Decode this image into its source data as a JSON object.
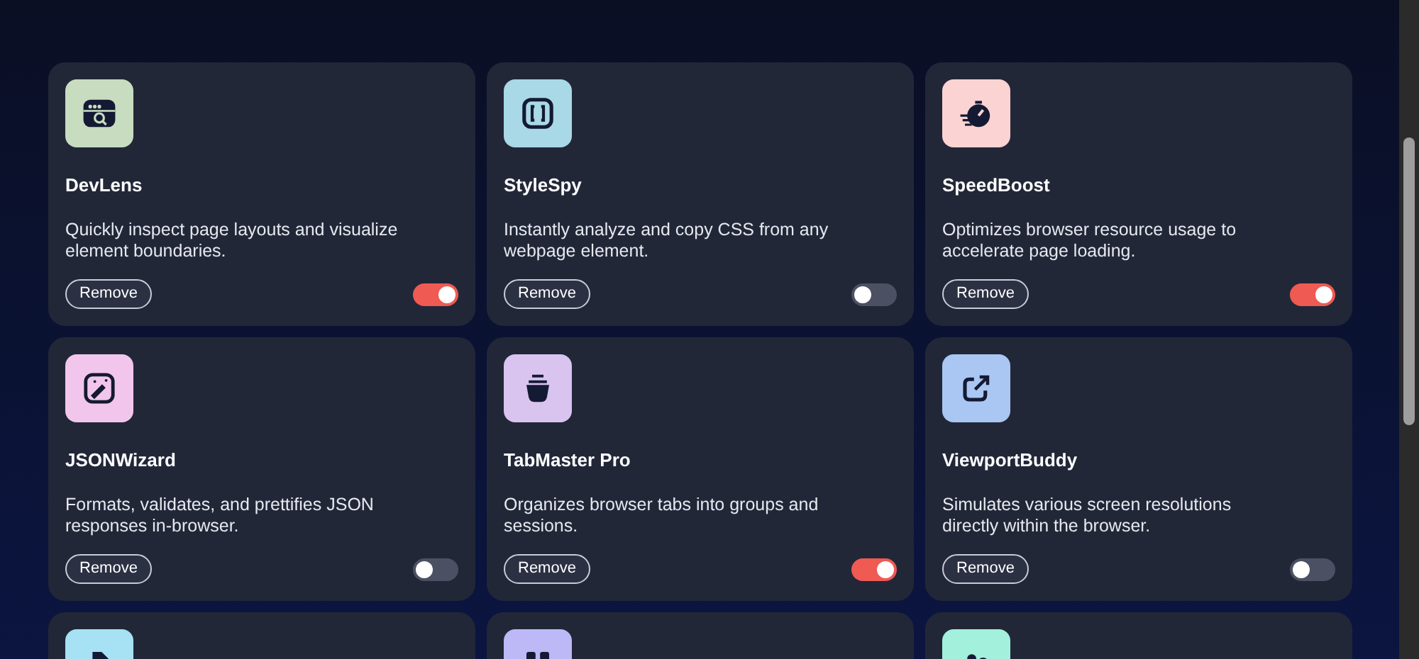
{
  "extensions": [
    {
      "name": "DevLens",
      "description": "Quickly inspect page layouts and visualize element boundaries.",
      "color": "#c8dcc0",
      "on": true,
      "button": "Remove"
    },
    {
      "name": "StyleSpy",
      "description": "Instantly analyze and copy CSS from any webpage element.",
      "color": "#a9d8e6",
      "on": false,
      "button": "Remove"
    },
    {
      "name": "SpeedBoost",
      "description": "Optimizes browser resource usage to accelerate page loading.",
      "color": "#fbd3d3",
      "on": true,
      "button": "Remove"
    },
    {
      "name": "JSONWizard",
      "description": "Formats, validates, and prettifies JSON responses in-browser.",
      "color": "#f2c6ec",
      "on": false,
      "button": "Remove"
    },
    {
      "name": "TabMaster Pro",
      "description": "Organizes browser tabs into groups and sessions.",
      "color": "#d9c3ef",
      "on": true,
      "button": "Remove"
    },
    {
      "name": "ViewportBuddy",
      "description": "Simulates various screen resolutions directly within the browser.",
      "color": "#a9c7f2",
      "on": false,
      "button": "Remove"
    },
    {
      "color": "#a6e2f3"
    },
    {
      "color": "#bdb8f6"
    },
    {
      "color": "#a3f0dd"
    }
  ]
}
